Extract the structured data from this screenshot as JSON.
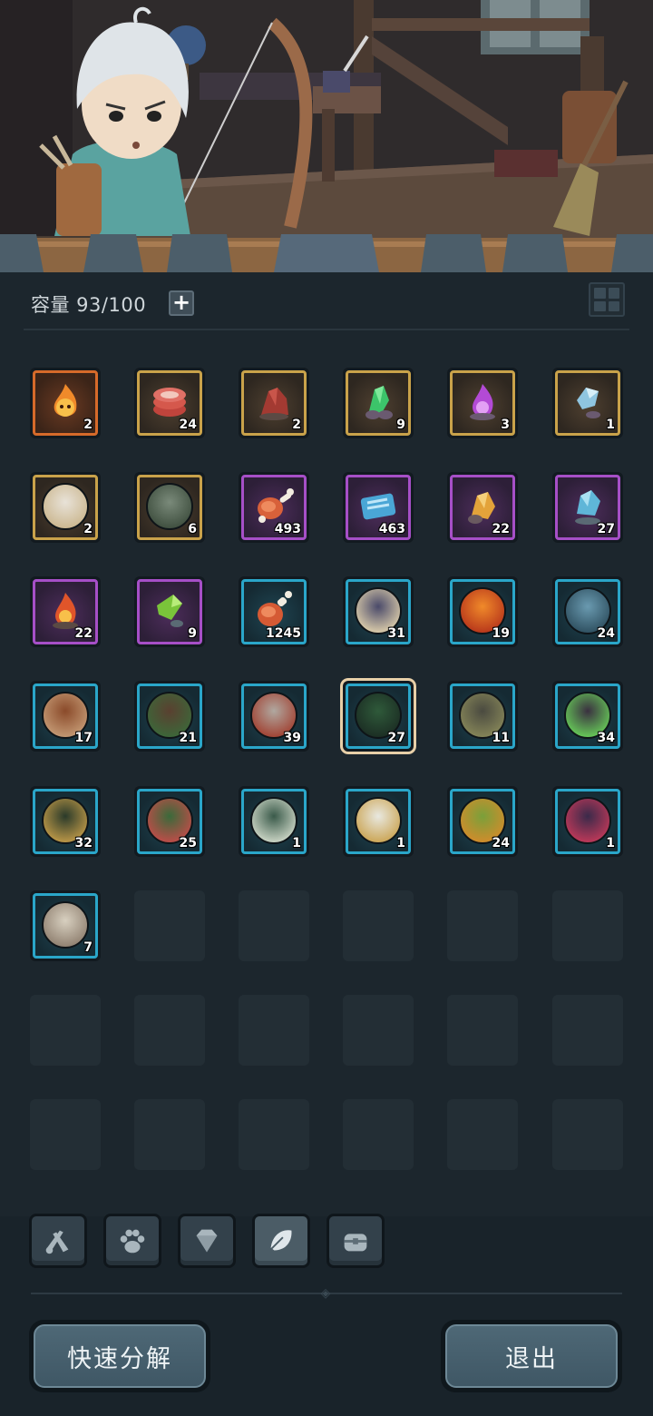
{
  "inventory": {
    "capacity_label": "容量 93/100",
    "add_capacity_icon": "plus-icon",
    "view_toggle_icon": "grid-icon",
    "rows": [
      [
        {
          "icon": "fire-spirit",
          "rarity": "orange",
          "count": "2"
        },
        {
          "icon": "raw-meat-stack",
          "rarity": "gold",
          "count": "24"
        },
        {
          "icon": "red-ore",
          "rarity": "gold",
          "count": "2"
        },
        {
          "icon": "green-crystal-ore",
          "rarity": "gold",
          "count": "9"
        },
        {
          "icon": "purple-flame-ore",
          "rarity": "gold",
          "count": "3"
        },
        {
          "icon": "blue-crystal",
          "rarity": "gold",
          "count": "1"
        }
      ],
      [
        {
          "icon": "white-hood-hero-portrait",
          "rarity": "gold",
          "count": "2"
        },
        {
          "icon": "rat-portrait",
          "rarity": "gold",
          "count": "6"
        },
        {
          "icon": "meat-bone",
          "rarity": "purple",
          "count": "493"
        },
        {
          "icon": "blue-scroll",
          "rarity": "purple",
          "count": "463"
        },
        {
          "icon": "gold-ore",
          "rarity": "purple",
          "count": "22"
        },
        {
          "icon": "ice-ore",
          "rarity": "purple",
          "count": "27"
        }
      ],
      [
        {
          "icon": "fire-ore",
          "rarity": "purple",
          "count": "22"
        },
        {
          "icon": "green-shard",
          "rarity": "purple",
          "count": "9"
        },
        {
          "icon": "roast-drumstick",
          "rarity": "cyan",
          "count": "1245"
        },
        {
          "icon": "hooded-ghost-portrait",
          "rarity": "cyan",
          "count": "31"
        },
        {
          "icon": "fire-orb-portrait",
          "rarity": "cyan",
          "count": "19"
        },
        {
          "icon": "frost-golem-portrait",
          "rarity": "cyan",
          "count": "24"
        }
      ],
      [
        {
          "icon": "lion-beast-portrait",
          "rarity": "cyan",
          "count": "17"
        },
        {
          "icon": "treant-portrait",
          "rarity": "cyan",
          "count": "21"
        },
        {
          "icon": "horned-dragon-portrait",
          "rarity": "cyan",
          "count": "39"
        },
        {
          "icon": "serpent-hair-portrait",
          "rarity": "cyan",
          "count": "27",
          "selected": true
        },
        {
          "icon": "stone-golem-portrait",
          "rarity": "cyan",
          "count": "11"
        },
        {
          "icon": "shadow-cat-portrait",
          "rarity": "cyan",
          "count": "34"
        }
      ],
      [
        {
          "icon": "shadow-imp-portrait",
          "rarity": "cyan",
          "count": "32"
        },
        {
          "icon": "green-dragon-portrait",
          "rarity": "cyan",
          "count": "25"
        },
        {
          "icon": "green-knight-portrait",
          "rarity": "cyan",
          "count": "1"
        },
        {
          "icon": "white-priestess-portrait",
          "rarity": "cyan",
          "count": "1"
        },
        {
          "icon": "thunder-dragon-portrait",
          "rarity": "cyan",
          "count": "24"
        },
        {
          "icon": "dark-demon-portrait",
          "rarity": "cyan",
          "count": "1"
        }
      ],
      [
        {
          "icon": "white-rat-portrait",
          "rarity": "cyan",
          "count": "7"
        },
        null,
        null,
        null,
        null,
        null
      ],
      [
        null,
        null,
        null,
        null,
        null,
        null
      ],
      [
        null,
        null,
        null,
        null,
        null,
        null
      ]
    ]
  },
  "tabs": [
    {
      "icon": "crossed-weapons-icon",
      "active": false
    },
    {
      "icon": "paw-icon",
      "active": false
    },
    {
      "icon": "gem-icon",
      "active": false
    },
    {
      "icon": "leaf-icon",
      "active": true
    },
    {
      "icon": "chest-icon",
      "active": false
    }
  ],
  "buttons": {
    "quick_decompose": "快速分解",
    "exit": "退出"
  },
  "colors": {
    "orange": "#d66a2a",
    "gold": "#c9a24a",
    "purple": "#a64fc7",
    "cyan": "#2aa6c9",
    "selected": "#e7cfa8"
  }
}
